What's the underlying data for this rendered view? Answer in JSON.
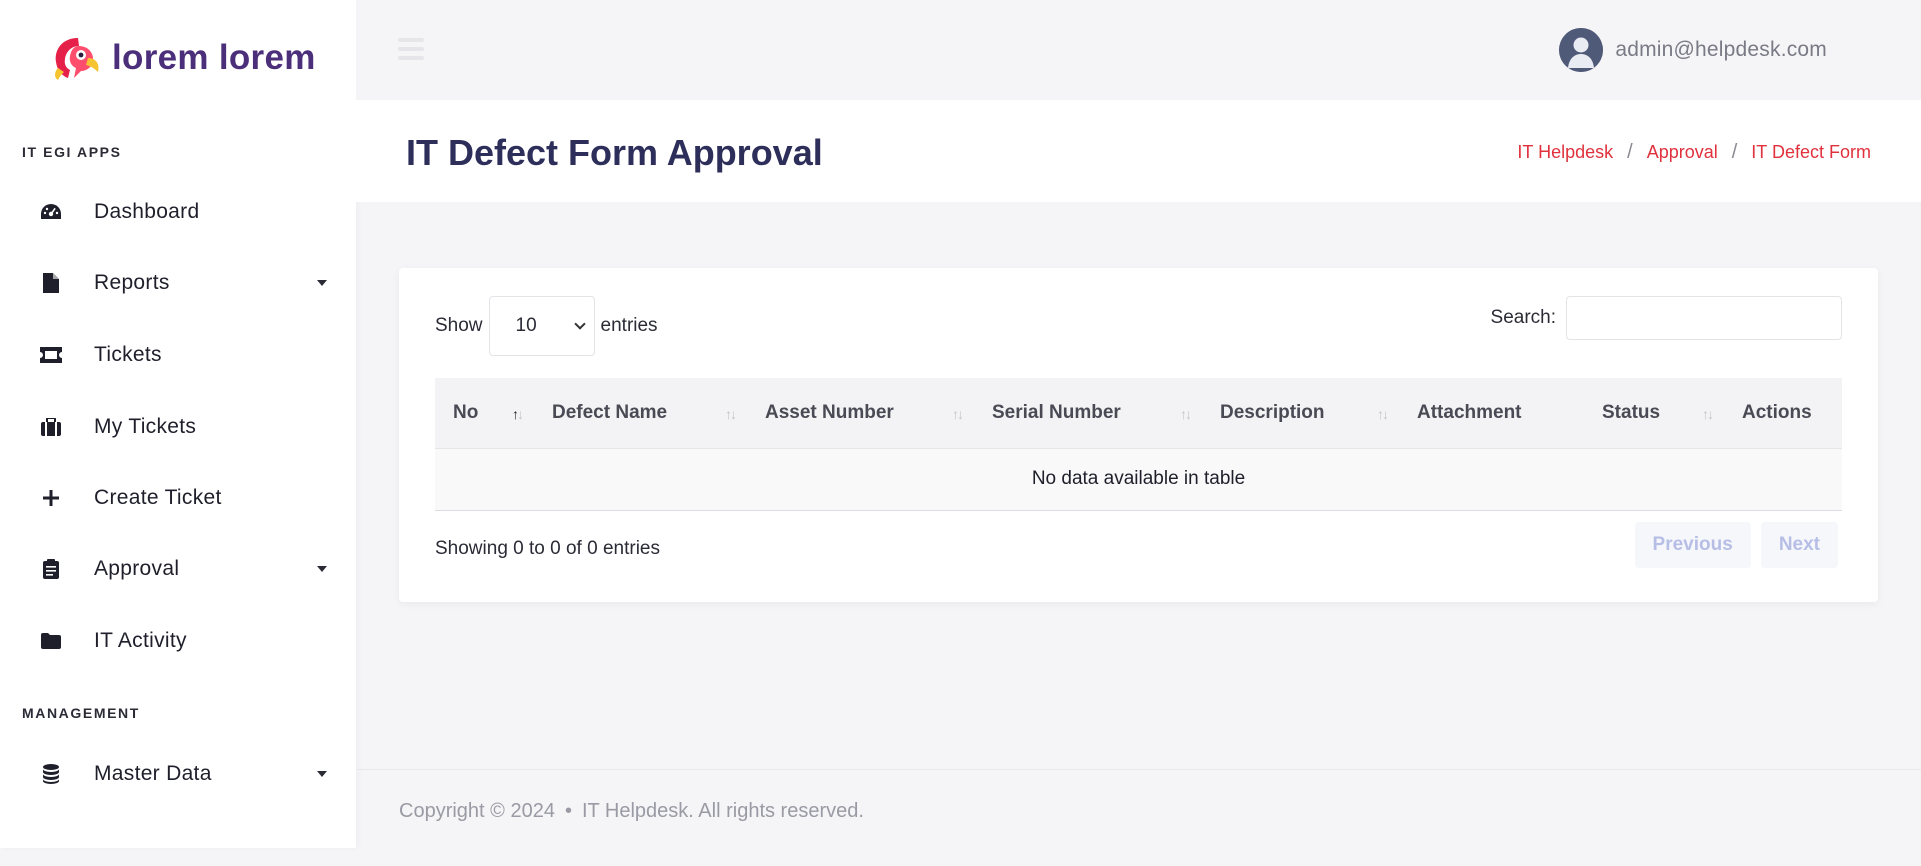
{
  "brand": {
    "name": "lorem lorem",
    "logo_icon": "parrot-logo"
  },
  "sidebar": {
    "sections": [
      {
        "label": "IT EGI APPS"
      },
      {
        "label": "MANAGEMENT"
      }
    ],
    "items": [
      {
        "label": "Dashboard",
        "icon": "dashboard-icon"
      },
      {
        "label": "Reports",
        "icon": "file-icon",
        "has_submenu": true
      },
      {
        "label": "Tickets",
        "icon": "ticket-icon"
      },
      {
        "label": "My Tickets",
        "icon": "briefcase-icon"
      },
      {
        "label": "Create Ticket",
        "icon": "plus-icon"
      },
      {
        "label": "Approval",
        "icon": "clipboard-icon",
        "has_submenu": true
      },
      {
        "label": "IT Activity",
        "icon": "folder-icon"
      },
      {
        "label": "Master Data",
        "icon": "database-icon",
        "has_submenu": true
      }
    ]
  },
  "topbar": {
    "user_email": "admin@helpdesk.com"
  },
  "page": {
    "title": "IT Defect Form Approval",
    "breadcrumb": [
      "IT Helpdesk",
      "Approval",
      "IT Defect Form"
    ],
    "breadcrumb_separator": "/"
  },
  "table_controls": {
    "show_label": "Show",
    "entries_label": "entries",
    "page_length": "10",
    "search_label": "Search:"
  },
  "table": {
    "columns": [
      {
        "label": "No",
        "sortable": true,
        "sorted": "asc"
      },
      {
        "label": "Defect Name",
        "sortable": true
      },
      {
        "label": "Asset Number",
        "sortable": true
      },
      {
        "label": "Serial Number",
        "sortable": true
      },
      {
        "label": "Description",
        "sortable": true
      },
      {
        "label": "Attachment",
        "sortable": false
      },
      {
        "label": "Status",
        "sortable": true
      },
      {
        "label": "Actions",
        "sortable": false
      }
    ],
    "rows": [],
    "empty_message": "No data available in table"
  },
  "pagination": {
    "info": "Showing 0 to 0 of 0 entries",
    "previous_label": "Previous",
    "next_label": "Next"
  },
  "footer": {
    "copyright": "Copyright © 2024",
    "bullet": "•",
    "text": "IT Helpdesk. All rights reserved."
  },
  "colors": {
    "brand_purple": "#4b2f7a",
    "title_navy": "#2d2e5a",
    "breadcrumb_red": "#e0313d",
    "pagination_disabled": "#b7bee6"
  }
}
